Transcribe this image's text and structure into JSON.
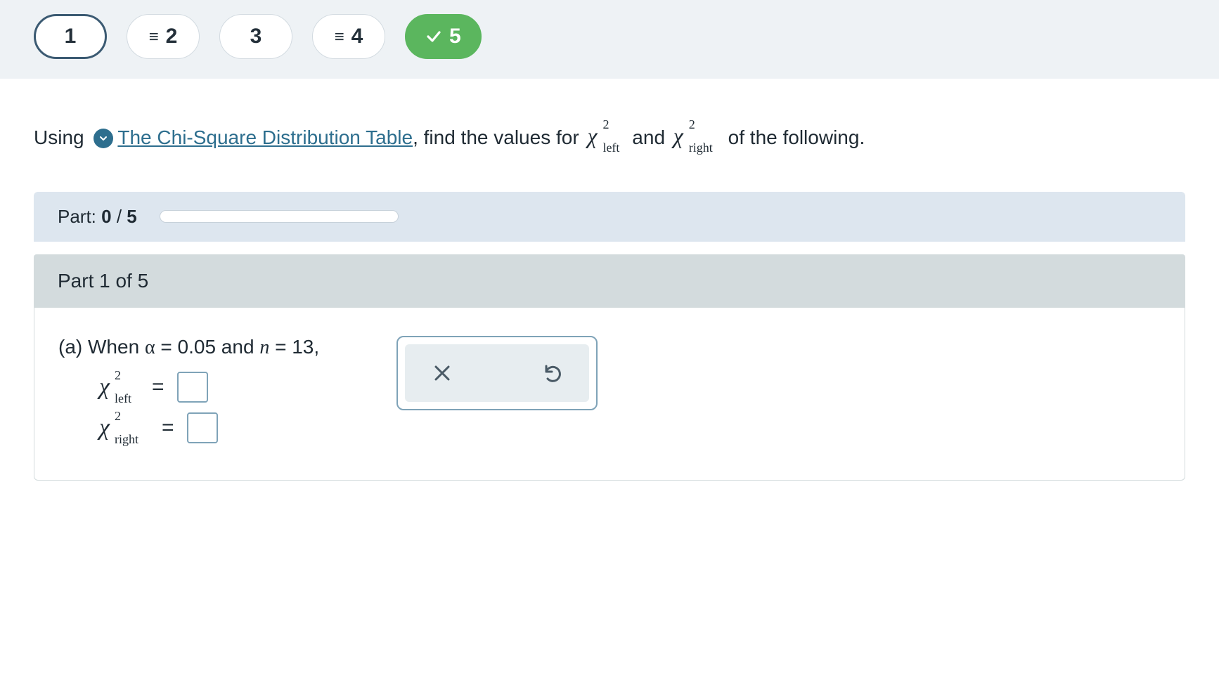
{
  "nav": {
    "items": [
      {
        "label": "1",
        "prefix": "",
        "state": "current"
      },
      {
        "label": "2",
        "prefix": "≡",
        "state": "default"
      },
      {
        "label": "3",
        "prefix": "",
        "state": "default"
      },
      {
        "label": "4",
        "prefix": "≡",
        "state": "default"
      },
      {
        "label": "5",
        "prefix": "",
        "state": "done"
      }
    ]
  },
  "prompt": {
    "lead": "Using ",
    "link_text": "The Chi-Square Distribution Table",
    "mid": ", find the values for ",
    "chi_left_sub": "left",
    "and": " and ",
    "chi_right_sub": "right",
    "tail": " of the following."
  },
  "progress": {
    "prefix": "Part: ",
    "current": "0",
    "sep": " / ",
    "total": "5",
    "percent": 0
  },
  "part": {
    "header": "Part 1 of 5",
    "q_label": "(a) When ",
    "alpha_sym": "α",
    "alpha_eq": " = ",
    "alpha_val": "0.05",
    "and_text": " and ",
    "n_sym": "n",
    "n_eq": " = ",
    "n_val": "13",
    "comma": ",",
    "eq1_sub": "left",
    "eq2_sub": "right",
    "eq_sign": "="
  },
  "actions": {
    "clear": "clear",
    "reset": "reset"
  }
}
